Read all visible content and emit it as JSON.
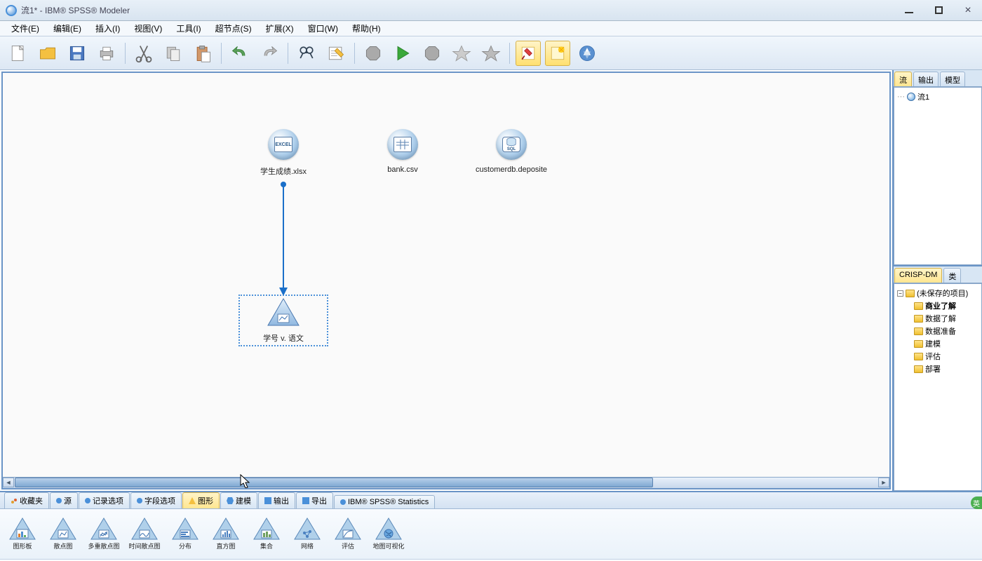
{
  "title": "流1* - IBM® SPSS® Modeler",
  "menus": {
    "file": "文件(E)",
    "edit": "编辑(E)",
    "insert": "插入(I)",
    "view": "视图(V)",
    "tools": "工具(I)",
    "supernode": "超节点(S)",
    "extensions": "扩展(X)",
    "window": "窗口(W)",
    "help": "帮助(H)"
  },
  "nodes": {
    "excel": {
      "label": "学生成绩.xlsx",
      "inner": "EXCEL"
    },
    "bank": {
      "label": "bank.csv"
    },
    "db": {
      "label": "customerdb.deposite",
      "inner": "SQL"
    },
    "plot": {
      "label": "学号 v. 语文"
    }
  },
  "right_upper_tabs": {
    "stream": "流",
    "output": "输出",
    "model": "模型"
  },
  "stream_tree": {
    "item1": "流1"
  },
  "right_lower_tabs": {
    "crispdm": "CRISP-DM",
    "class": "类"
  },
  "crisp_tree": {
    "root": "(未保存的项目)",
    "business": "商业了解",
    "data_understanding": "数据了解",
    "data_prep": "数据准备",
    "modeling": "建模",
    "evaluation": "评估",
    "deployment": "部署"
  },
  "palette_tabs": {
    "favorites": "收藏夹",
    "sources": "源",
    "record_ops": "记录选项",
    "field_ops": "字段选项",
    "graphs": "图形",
    "modeling": "建模",
    "output": "输出",
    "export": "导出",
    "stats": "IBM® SPSS® Statistics"
  },
  "palette_items": {
    "graphboard": "图形板",
    "plot": "散点图",
    "multiplot": "多重散点图",
    "timeplot": "时间散点图",
    "distribution": "分布",
    "histogram": "直方图",
    "collection": "集合",
    "web": "网络",
    "evaluation": "评估",
    "mapviz": "地图可视化"
  },
  "lang_badge": "英"
}
